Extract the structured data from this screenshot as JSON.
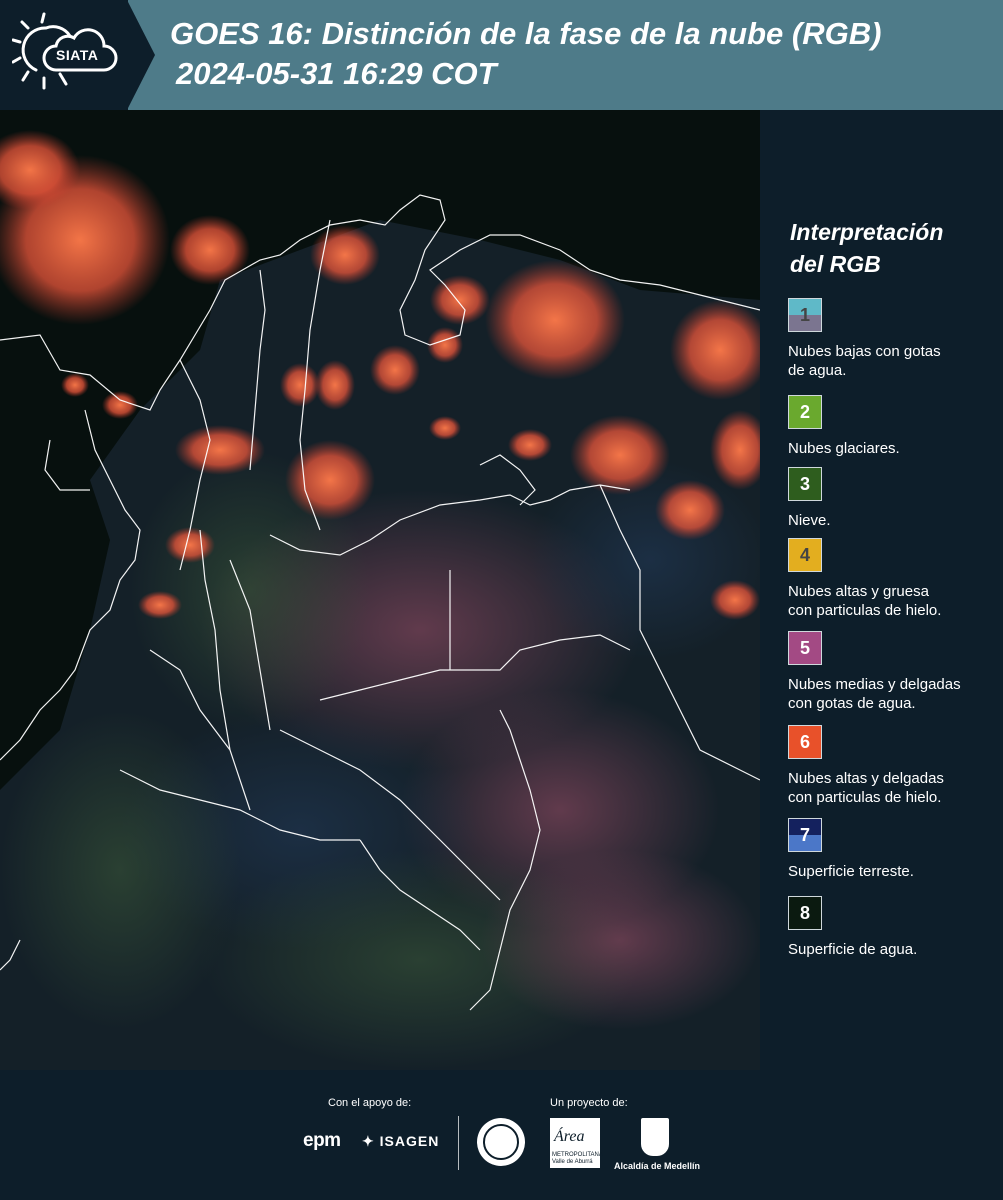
{
  "header": {
    "logo_text": "SIATA",
    "title_line1": "GOES 16: Distinción de la fase de la nube (RGB)",
    "title_line2": "2024-05-31 16:29 COT"
  },
  "legend": {
    "title_line1": "Interpretación",
    "title_line2": "del RGB",
    "items": [
      {
        "num": "1",
        "label_line1": "Nubes bajas con gotas",
        "label_line2": "de agua.",
        "top_color": "#5fb9c8",
        "bottom_color": "#7b7590",
        "num_color": "#444444"
      },
      {
        "num": "2",
        "label_line1": "Nubes glaciares.",
        "label_line2": "",
        "top_color": "#6aa92e",
        "bottom_color": "#6aa92e",
        "num_color": "#ffffff"
      },
      {
        "num": "3",
        "label_line1": "Nieve.",
        "label_line2": "",
        "top_color": "#2e5d1e",
        "bottom_color": "#2e5d1e",
        "num_color": "#ffffff"
      },
      {
        "num": "4",
        "label_line1": "Nubes altas y gruesa",
        "label_line2": "con particulas de hielo.",
        "top_color": "#e3ae1f",
        "bottom_color": "#e3ae1f",
        "num_color": "#444444"
      },
      {
        "num": "5",
        "label_line1": "Nubes medias y delgadas",
        "label_line2": "con gotas de agua.",
        "top_color": "#a34a84",
        "bottom_color": "#a34a84",
        "num_color": "#ffffff"
      },
      {
        "num": "6",
        "label_line1": "Nubes altas y delgadas",
        "label_line2": "con particulas de hielo.",
        "top_color": "#e8512a",
        "bottom_color": "#e8512a",
        "num_color": "#ffffff"
      },
      {
        "num": "7",
        "label_line1": "Superficie terreste.",
        "label_line2": "",
        "top_color": "#14215e",
        "bottom_color": "#4b77c8",
        "num_color": "#ffffff"
      },
      {
        "num": "8",
        "label_line1": "Superficie de agua.",
        "label_line2": "",
        "top_color": "#0b1a10",
        "bottom_color": "#0b1a10",
        "num_color": "#ffffff"
      }
    ]
  },
  "footer": {
    "support_label": "Con el apoyo de:",
    "project_label": "Un proyecto de:",
    "epm": "epm",
    "isagen": "ISAGEN",
    "area_text": "Área",
    "area_sub1": "METROPOLITANA",
    "area_sub2": "Valle de Aburrá",
    "alcaldia": "Alcaldía de Medellín"
  },
  "colors": {
    "header_bg": "#4e7b89",
    "dark_bg": "#0d1e2a",
    "cloud_orange": "#f0643a"
  }
}
